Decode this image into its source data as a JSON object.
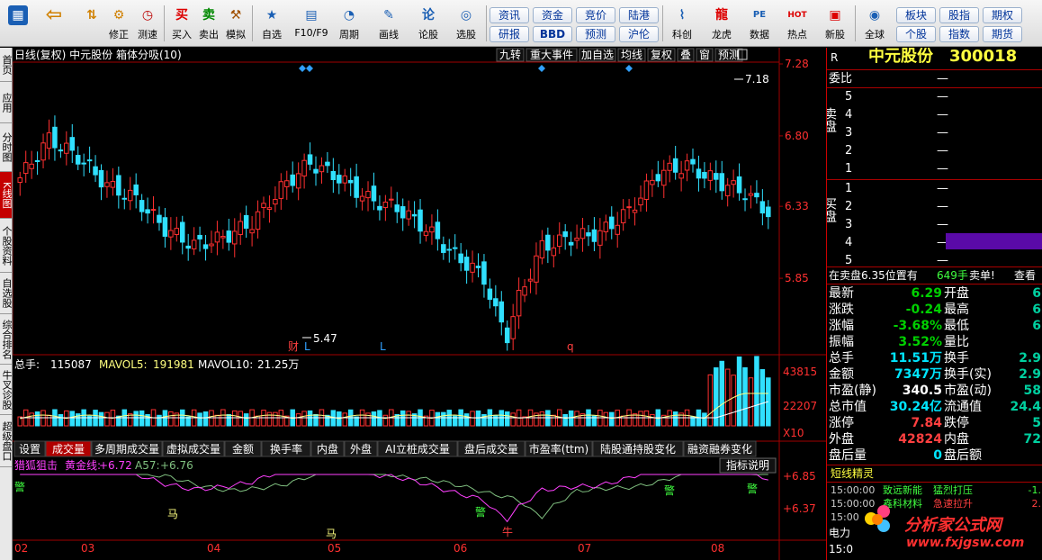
{
  "toolbar": {
    "buttons": [
      "修正",
      "测速",
      "买入",
      "卖出",
      "模拟",
      "自选",
      "F10/F9",
      "周期",
      "画线",
      "论股",
      "选股"
    ],
    "pills_row1": [
      "资讯",
      "资金",
      "竞价",
      "陆港"
    ],
    "pills_row2": [
      "研报",
      "BBD",
      "预测",
      "沪伦"
    ],
    "buttons2": [
      "科创",
      "龙虎",
      "数据",
      "热点",
      "新股",
      "全球"
    ],
    "pills_right_row1": [
      "板块",
      "股指",
      "期权"
    ],
    "pills_right_row2": [
      "个股",
      "指数",
      "期货"
    ],
    "icon_glyphs": {
      "buy": "买",
      "sell": "卖",
      "lun": "论",
      "pe": "PE",
      "hot": "HOT"
    }
  },
  "leftbar": {
    "items": [
      "首页",
      "应用",
      "分时图",
      "K线图",
      "个股资料",
      "自选股",
      "综合排名",
      "牛叉诊股",
      "超级盘口"
    ],
    "active_index": 3
  },
  "chart_header": {
    "left_text": "日线(复权)  中元股份  箱体分吸(10)",
    "buttons": [
      "九转",
      "重大事件",
      "加自选",
      "均线",
      "复权",
      "叠",
      "窗",
      "预测"
    ]
  },
  "price_axis": [
    "7.28",
    "6.80",
    "6.33",
    "5.85"
  ],
  "annotations": {
    "high": "7.18",
    "low": "5.47",
    "cai": "财",
    "L1": "L",
    "L2": "L",
    "q": "q"
  },
  "volume_header": {
    "total_label": "总手: ",
    "total": "115087",
    "mavol5_label": "MAVOL5: ",
    "mavol5": "191981",
    "mavol10_label": "MAVOL10: ",
    "mavol10": "21.25万"
  },
  "volume_axis": [
    "43815",
    "22207",
    "X10"
  ],
  "tabs": [
    "设置",
    "成交量",
    "多周期成交量",
    "虚拟成交量",
    "金额",
    "换手率",
    "内盘",
    "外盘",
    "AI立桩成交量",
    "盘后成交量",
    "市盈率(ttm)",
    "陆股通持股变化",
    "融资融券变化"
  ],
  "active_tab": 1,
  "indicator": {
    "name": "猎狐狙击",
    "l1_label": "黄金线:",
    "l1": "+6.72",
    "l2_label": "A57:",
    "l2": "+6.76",
    "help": "指标说明",
    "axis": [
      "+6.85",
      "+6.37"
    ],
    "marks": [
      "警",
      "马",
      "马",
      "警",
      "牛",
      "警",
      "警"
    ]
  },
  "dates": [
    "02",
    "03",
    "04",
    "05",
    "06",
    "07",
    "08"
  ],
  "right": {
    "flag": "R",
    "stock_name": "中元股份",
    "stock_code": "300018",
    "weibi_label": "委比",
    "weibi_value": "—",
    "sell_label": "卖盘",
    "buy_label": "买盘",
    "levels_sell": [
      "5",
      "4",
      "3",
      "2",
      "1"
    ],
    "levels_buy": [
      "1",
      "2",
      "3",
      "4",
      "5"
    ],
    "dash": "—",
    "info_line": "在卖盘6.35位置有",
    "info_qty": "649手",
    "info_tag": "卖单!",
    "info_more": "查看",
    "quotes_left": [
      {
        "label": "最新",
        "value": "6.29",
        "color": "#00d000"
      },
      {
        "label": "涨跌",
        "value": "-0.24",
        "color": "#00d000"
      },
      {
        "label": "涨幅",
        "value": "-3.68%",
        "color": "#00d000"
      },
      {
        "label": "振幅",
        "value": "3.52%",
        "color": "#00d000"
      },
      {
        "label": "总手",
        "value": "11.51万",
        "color": "#00e5ff"
      },
      {
        "label": "金额",
        "value": "7347万",
        "color": "#00e5ff"
      },
      {
        "label": "市盈(静)",
        "value": "340.5",
        "color": "#ffffff"
      },
      {
        "label": "总市值",
        "value": "30.24亿",
        "color": "#00e5ff"
      },
      {
        "label": "涨停",
        "value": "7.84",
        "color": "#ff4040"
      },
      {
        "label": "外盘",
        "value": "42824",
        "color": "#ff4040"
      },
      {
        "label": "盘后量",
        "value": "0",
        "color": "#00e5ff"
      }
    ],
    "quotes_right": [
      {
        "label": "开盘",
        "value": "6"
      },
      {
        "label": "最高",
        "value": "6"
      },
      {
        "label": "最低",
        "value": "6"
      },
      {
        "label": "量比",
        "value": ""
      },
      {
        "label": "换手",
        "value": "2.9"
      },
      {
        "label": "换手(实)",
        "value": "2.9"
      },
      {
        "label": "市盈(动)",
        "value": "58"
      },
      {
        "label": "流通值",
        "value": "24.4"
      },
      {
        "label": "跌停",
        "value": "5"
      },
      {
        "label": "内盘",
        "value": "72"
      },
      {
        "label": "盘后额",
        "value": ""
      }
    ],
    "news_title": "短线精灵",
    "news": [
      {
        "time": "15:00:00",
        "name": "致远新能",
        "event": "猛烈打压",
        "val": "-1."
      },
      {
        "time": "15:00:00",
        "name": "鑫科材料",
        "event": "急速拉升",
        "val": "2."
      },
      {
        "time": "15:00",
        "name": "",
        "event": "",
        "val": ""
      }
    ],
    "bottom_label": "电力",
    "bottom_time": "15:0",
    "watermark": "分析家公式网",
    "watermark_url": "www.fxjgsw.com"
  },
  "chart_data": {
    "type": "candlestick",
    "ylim": [
      5.37,
      7.28
    ],
    "count": 130,
    "anchors_close": [
      [
        0,
        6.52
      ],
      [
        5,
        6.78
      ],
      [
        10,
        6.66
      ],
      [
        15,
        6.47
      ],
      [
        20,
        6.38
      ],
      [
        25,
        6.18
      ],
      [
        30,
        6.07
      ],
      [
        35,
        6.12
      ],
      [
        40,
        6.22
      ],
      [
        45,
        6.45
      ],
      [
        50,
        6.62
      ],
      [
        55,
        6.52
      ],
      [
        60,
        6.38
      ],
      [
        65,
        6.32
      ],
      [
        70,
        6.18
      ],
      [
        75,
        6.0
      ],
      [
        78,
        5.92
      ],
      [
        80,
        5.85
      ],
      [
        82,
        5.62
      ],
      [
        84,
        5.47
      ],
      [
        86,
        5.72
      ],
      [
        90,
        6.06
      ],
      [
        95,
        6.12
      ],
      [
        100,
        6.15
      ],
      [
        105,
        6.3
      ],
      [
        110,
        6.55
      ],
      [
        115,
        6.6
      ],
      [
        120,
        6.5
      ],
      [
        125,
        6.42
      ],
      [
        129,
        6.29
      ]
    ],
    "colors": {
      "up": "#ff3030",
      "down": "#30e0ff",
      "volume_up": "#ff3030",
      "volume_down": "#30e0ff",
      "ma5": "#ffff80",
      "ma10": "#ffffff",
      "gold": "#ff40ff",
      "a57": "#80c080"
    }
  }
}
